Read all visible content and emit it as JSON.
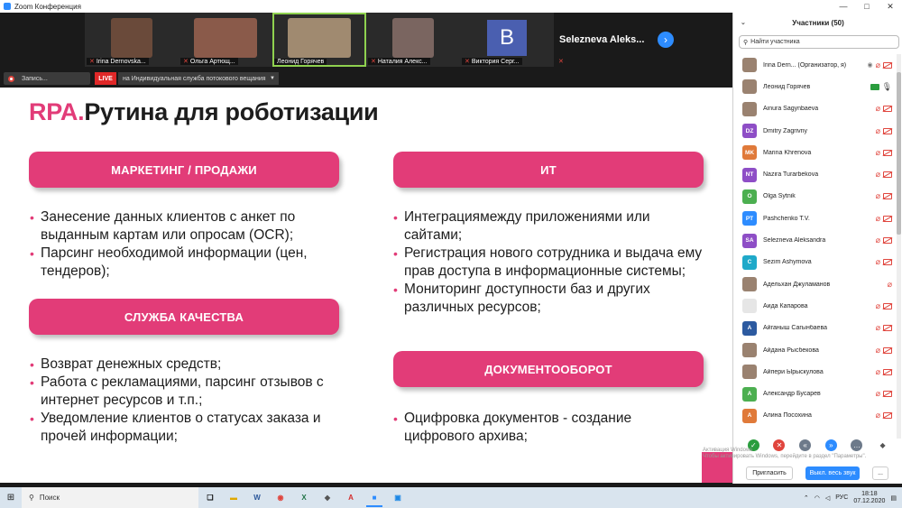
{
  "window": {
    "title": "Zoom Конференция",
    "controls": [
      "—",
      "□",
      "✕"
    ]
  },
  "strip": {
    "tiles": [
      {
        "name": "Irina Dernovska...",
        "color": "#6a4a3a"
      },
      {
        "name": "Ольга Артющ...",
        "color": "#8a5a4a"
      },
      {
        "name": "Леонид Горячев",
        "color": "#a08a70"
      },
      {
        "name": "Наталия Алекс...",
        "color": "#7a6560"
      },
      {
        "name": "Виктория Серг...",
        "initial": "B"
      }
    ],
    "overflow_name": "Selezneva  Aleks...",
    "next_icon": "›"
  },
  "sharebar": {
    "record_label": "Запись...",
    "live_label": "LIVE",
    "live_service": "на Индивидуальная служба потокового вещания"
  },
  "slide": {
    "title_accent": "RPA.",
    "title_rest": "Рутина для роботизации",
    "sections": {
      "marketing": {
        "header": "МАРКЕТИНГ / ПРОДАЖИ",
        "items": [
          "Занесение данных клиентов с анкет по выданным картам или опросам (OCR);",
          "Парсинг необходимой информации (цен, тендеров);"
        ]
      },
      "quality": {
        "header": "СЛУЖБА КАЧЕСТВА",
        "items": [
          "Возврат денежных средств;",
          "Работа с рекламациями, парсинг отзывов с интернет ресурсов и т.п.;",
          "Уведомление клиентов о статусах заказа и прочей информации;"
        ]
      },
      "it": {
        "header": "ИТ",
        "items": [
          "Интеграциямежду приложениями или сайтами;",
          "Регистрация нового сотрудника и выдача ему прав доступа в информационные системы;",
          "Мониторинг доступности баз и других различных ресурсов;"
        ]
      },
      "docs": {
        "header": "ДОКУМЕНТООБОРОТ",
        "items": [
          "Оцифровка документов - создание цифрового архива;"
        ]
      }
    },
    "accent_color": "#e23c78"
  },
  "participants": {
    "title": "Участники (50)",
    "search_placeholder": "Найти участника",
    "list": [
      {
        "name": "Irina Dern... (Организатор, я)",
        "avatar": "photo",
        "mic": "off",
        "cam": "off",
        "extra": "◉"
      },
      {
        "name": "Леонид Горячев",
        "avatar": "photo",
        "mic": "on",
        "cam": "on"
      },
      {
        "name": "Ainura Sagynbaeva",
        "avatar": "photo",
        "mic": "off",
        "cam": "off"
      },
      {
        "name": "Dmitry Zagrivny",
        "initials": "DZ",
        "color": "#8e4ec6",
        "mic": "off",
        "cam": "off"
      },
      {
        "name": "Marina Khrenova",
        "initials": "MK",
        "color": "#e07a3a",
        "mic": "off",
        "cam": "off"
      },
      {
        "name": "Nazira Turarbekova",
        "initials": "NT",
        "color": "#8e4ec6",
        "mic": "off",
        "cam": "off"
      },
      {
        "name": "Olga Sytnik",
        "initials": "O",
        "color": "#4caf50",
        "mic": "off",
        "cam": "off"
      },
      {
        "name": "Pashchenko T.V.",
        "initials": "PT",
        "color": "#2d8cff",
        "mic": "off",
        "cam": "off"
      },
      {
        "name": "Selezneva Aleksandra",
        "initials": "SA",
        "color": "#8e4ec6",
        "mic": "off",
        "cam": "off"
      },
      {
        "name": "Sezim Ashymova",
        "initials": "C",
        "color": "#1fa9c9",
        "mic": "off",
        "cam": "off"
      },
      {
        "name": "Адельхан Джуламанов",
        "avatar": "photo",
        "mic": "off",
        "cam": "none"
      },
      {
        "name": "Аида Капарова",
        "avatar": "blank",
        "mic": "off",
        "cam": "off"
      },
      {
        "name": "Айганыш Сагынбаева",
        "initials": "A",
        "color": "#2c5aa0",
        "mic": "off",
        "cam": "off"
      },
      {
        "name": "Айдана Рысбекова",
        "avatar": "photo",
        "mic": "off",
        "cam": "off"
      },
      {
        "name": "Айпери Ырыскулова",
        "avatar": "photo",
        "mic": "off",
        "cam": "off"
      },
      {
        "name": "Александр Бусарев",
        "initials": "A",
        "color": "#4caf50",
        "mic": "off",
        "cam": "off"
      },
      {
        "name": "Алина Посохина",
        "initials": "A",
        "color": "#e07a3a",
        "mic": "off",
        "cam": "off"
      }
    ],
    "watermark": [
      "Активация Windows",
      "Чтобы активировать Windows, перейдите в раздел \"Параметры\"."
    ],
    "invite_label": "Пригласить",
    "mute_all_label": "Выкл. весь звук",
    "more_label": "..."
  },
  "taskbar": {
    "search_label": "Поиск",
    "lang": "РУС",
    "time": "18:18",
    "date": "07.12.2020"
  }
}
